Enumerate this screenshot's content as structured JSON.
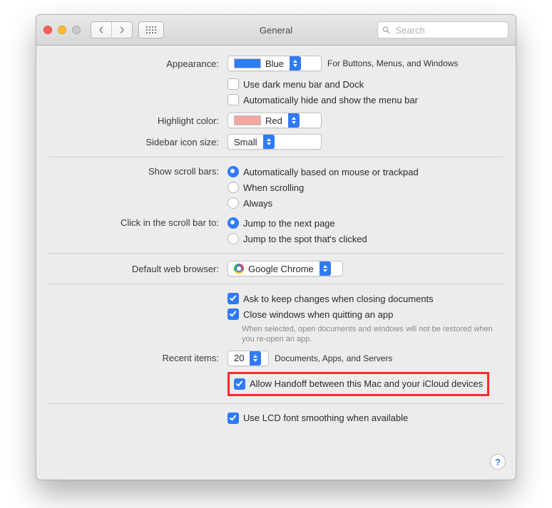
{
  "window": {
    "title": "General"
  },
  "toolbar": {
    "search_placeholder": "Search"
  },
  "appearance": {
    "label": "Appearance:",
    "value": "Blue",
    "note": "For Buttons, Menus, and Windows",
    "dark_menu": "Use dark menu bar and Dock",
    "auto_hide": "Automatically hide and show the menu bar"
  },
  "highlight": {
    "label": "Highlight color:",
    "value": "Red"
  },
  "sidebar": {
    "label": "Sidebar icon size:",
    "value": "Small"
  },
  "scrollbars": {
    "label": "Show scroll bars:",
    "opt1": "Automatically based on mouse or trackpad",
    "opt2": "When scrolling",
    "opt3": "Always"
  },
  "scrollclick": {
    "label": "Click in the scroll bar to:",
    "opt1": "Jump to the next page",
    "opt2": "Jump to the spot that's clicked"
  },
  "browser": {
    "label": "Default web browser:",
    "value": "Google Chrome"
  },
  "documents": {
    "ask": "Ask to keep changes when closing documents",
    "close": "Close windows when quitting an app",
    "hint": "When selected, open documents and windows will not be restored when you re-open an app."
  },
  "recent": {
    "label": "Recent items:",
    "value": "20",
    "note": "Documents, Apps, and Servers"
  },
  "handoff": {
    "label": "Allow Handoff between this Mac and your iCloud devices"
  },
  "lcd": {
    "label": "Use LCD font smoothing when available"
  },
  "help": "?"
}
